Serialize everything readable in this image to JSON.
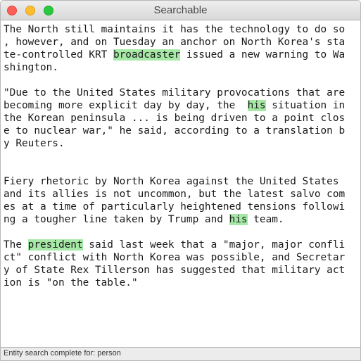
{
  "window": {
    "title": "Searchable",
    "controls": {
      "close": "close-button",
      "minimize": "minimize-button",
      "zoom": "zoom-button"
    }
  },
  "document": {
    "highlight_color": "#a6e8a6",
    "lines": [
      [
        {
          "t": "The North still maintains it has the technology to do so"
        }
      ],
      [
        {
          "t": ", however, and on Tuesday an anchor on North Korea's sta"
        }
      ],
      [
        {
          "t": "te-controlled KRT "
        },
        {
          "t": "broadcaster",
          "hl": true
        },
        {
          "t": " issued a new warning to Wa"
        }
      ],
      [
        {
          "t": "shington."
        }
      ],
      [],
      [
        {
          "t": "\"Due to the United States military provocations that are"
        }
      ],
      [
        {
          "t": "becoming more explicit day by day, the  "
        },
        {
          "t": "his",
          "hl": true
        },
        {
          "t": " situation in"
        }
      ],
      [
        {
          "t": "the Korean peninsula ... is being driven to a point clos"
        }
      ],
      [
        {
          "t": "e to nuclear war,\" he said, according to a translation b"
        }
      ],
      [
        {
          "t": "y Reuters."
        }
      ],
      [],
      [],
      [
        {
          "t": "Fiery rhetoric by North Korea against the United States"
        }
      ],
      [
        {
          "t": "and its allies is not uncommon, but the latest salvo com"
        }
      ],
      [
        {
          "t": "es at a time of particularly heightened tensions followi"
        }
      ],
      [
        {
          "t": "ng a tougher line taken by Trump and "
        },
        {
          "t": "his",
          "hl": true
        },
        {
          "t": " team."
        }
      ],
      [],
      [
        {
          "t": "The "
        },
        {
          "t": "president",
          "hl": true
        },
        {
          "t": " said last week that a \"major, major confli"
        }
      ],
      [
        {
          "t": "ct\" conflict with North Korea was possible, and Secretar"
        }
      ],
      [
        {
          "t": "y of State Rex Tillerson has suggested that military act"
        }
      ],
      [
        {
          "t": "ion is \"on the table.\""
        }
      ]
    ]
  },
  "status": {
    "text": "Entity search complete for: person"
  }
}
